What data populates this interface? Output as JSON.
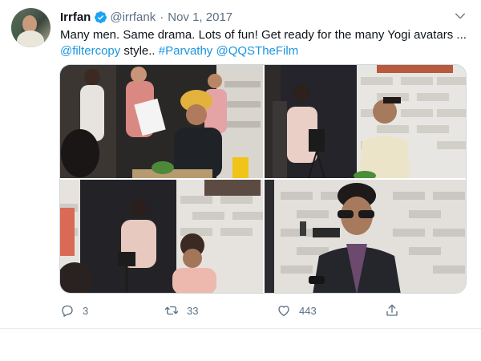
{
  "tweet": {
    "author_name": "Irrfan",
    "handle": "@irrfank",
    "separator": "·",
    "date": "Nov 1, 2017",
    "line1": "Many men. Same drama. Lots of fun! Get ready for the many Yogi avatars ...",
    "mention1": "@filtercopy",
    "text_mid": " style.. ",
    "hashtag": "#Parvathy",
    "space": " ",
    "mention2": "@QQSTheFilm",
    "verified_icon": "verified-badge-icon",
    "menu_icon": "chevron-down-icon"
  },
  "actions": {
    "reply_count": "3",
    "retweet_count": "33",
    "like_count": "443"
  },
  "colors": {
    "link": "#1b95e0",
    "secondary_text": "#5b7083",
    "verified": "#1da1f2"
  }
}
